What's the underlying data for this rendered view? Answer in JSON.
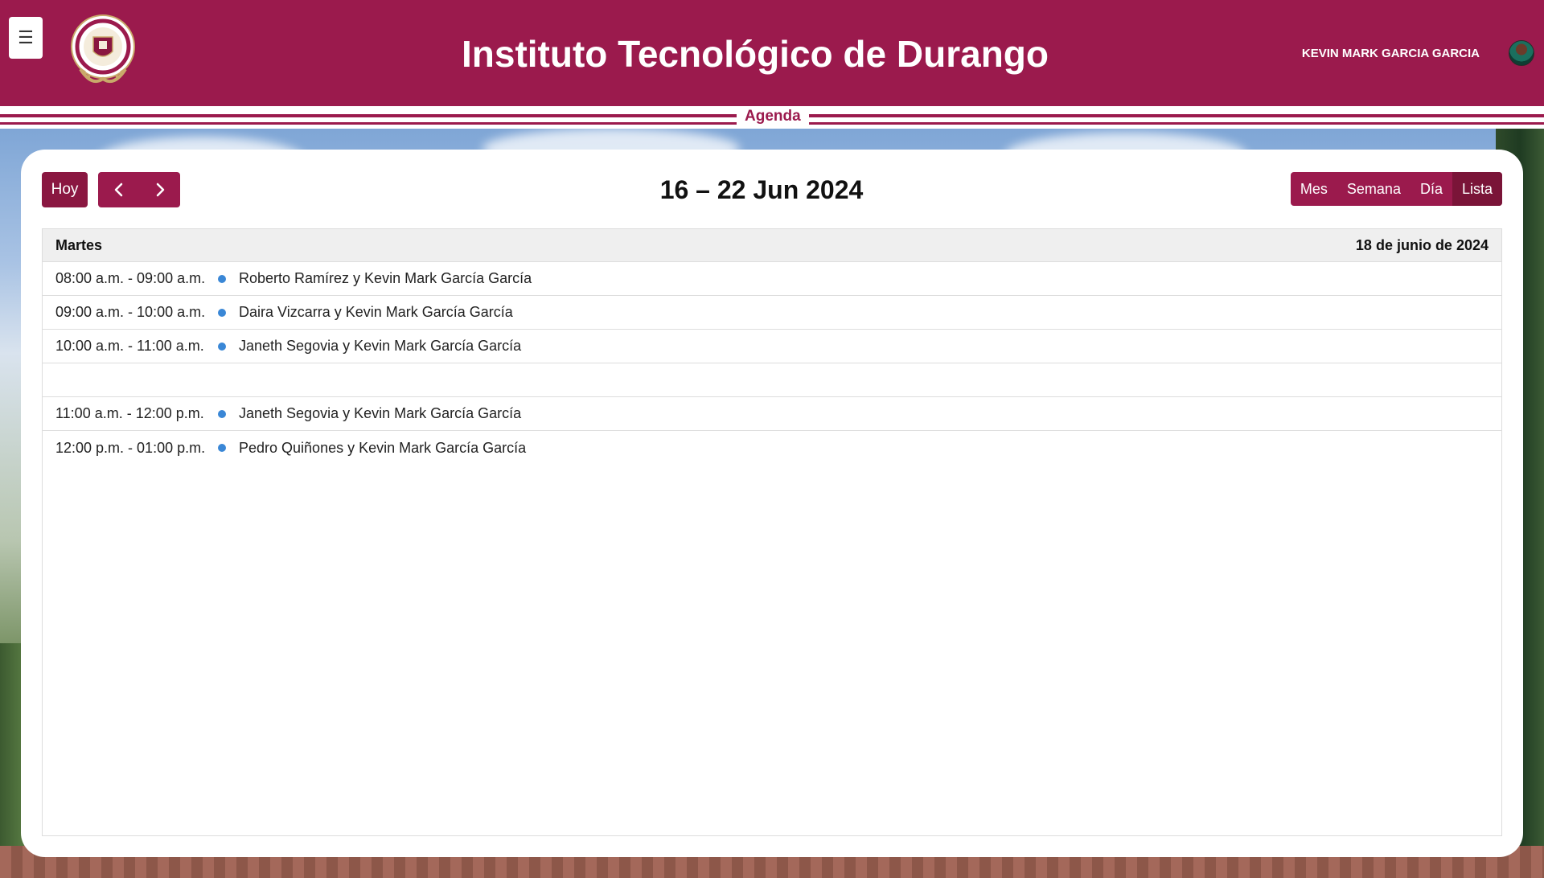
{
  "header": {
    "menu_icon": "☰",
    "title": "Instituto Tecnológico de Durango",
    "user_name": "KEVIN MARK GARCIA GARCIA",
    "section_label": "Agenda",
    "brand_color": "#9b1a4d"
  },
  "toolbar": {
    "today_label": "Hoy",
    "prev_icon": "chevron-left-icon",
    "next_icon": "chevron-right-icon",
    "range_title": "16 – 22 Jun 2024",
    "views": [
      {
        "label": "Mes",
        "active": false
      },
      {
        "label": "Semana",
        "active": false
      },
      {
        "label": "Día",
        "active": false
      },
      {
        "label": "Lista",
        "active": true
      }
    ]
  },
  "list": {
    "day_name": "Martes",
    "day_date": "18 de junio de 2024",
    "event_color": "#3a87d6",
    "events": [
      {
        "time": "08:00 a.m. - 09:00 a.m.",
        "title": "Roberto Ramírez y Kevin Mark García García"
      },
      {
        "time": "09:00 a.m. - 10:00 a.m.",
        "title": "Daira Vizcarra y Kevin Mark García García"
      },
      {
        "time": "10:00 a.m. - 11:00 a.m.",
        "title": "Janeth Segovia y Kevin Mark García García"
      },
      {
        "time": "11:00 a.m. - 12:00 p.m.",
        "title": "Janeth Segovia y Kevin Mark García García"
      },
      {
        "time": "12:00 p.m. - 01:00 p.m.",
        "title": "Pedro Quiñones y Kevin Mark García García"
      }
    ]
  }
}
